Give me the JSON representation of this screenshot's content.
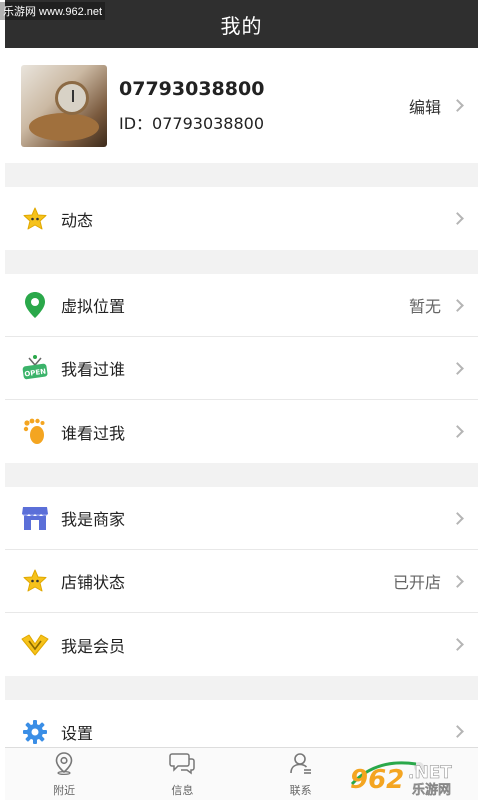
{
  "watermark": {
    "top_text": "乐游网 www.962.net",
    "logo_text": "962 NET",
    "logo_sub": "乐游网"
  },
  "header": {
    "title": "我的"
  },
  "profile": {
    "name": "07793038800",
    "id_label": "ID：",
    "id_value": "07793038800",
    "edit_label": "编辑"
  },
  "groups": [
    {
      "rows": [
        {
          "label": "动态",
          "value": "",
          "icon": "star-badge-icon"
        }
      ]
    },
    {
      "rows": [
        {
          "label": "虚拟位置",
          "value": "暂无",
          "icon": "location-pin-icon"
        },
        {
          "label": "我看过谁",
          "value": "",
          "icon": "open-sign-icon"
        },
        {
          "label": "谁看过我",
          "value": "",
          "icon": "footprint-icon"
        }
      ]
    },
    {
      "rows": [
        {
          "label": "我是商家",
          "value": "",
          "icon": "store-icon"
        },
        {
          "label": "店铺状态",
          "value": "已开店",
          "icon": "star-badge-icon"
        },
        {
          "label": "我是会员",
          "value": "",
          "icon": "vip-chevron-icon"
        }
      ]
    },
    {
      "rows": [
        {
          "label": "设置",
          "value": "",
          "icon": "gear-icon"
        }
      ]
    }
  ],
  "tabs": [
    {
      "label": "附近",
      "icon": "pin-outline-icon"
    },
    {
      "label": "信息",
      "icon": "chat-bubble-icon"
    },
    {
      "label": "联系",
      "icon": "contacts-icon"
    },
    {
      "label": "",
      "icon": "profile-icon"
    }
  ],
  "colors": {
    "header_bg": "#2f2f2f",
    "pin_green": "#2aa84a",
    "star_yellow": "#f6c21b",
    "store_blue": "#5b6fd8",
    "gear_blue": "#3a8ee6"
  }
}
